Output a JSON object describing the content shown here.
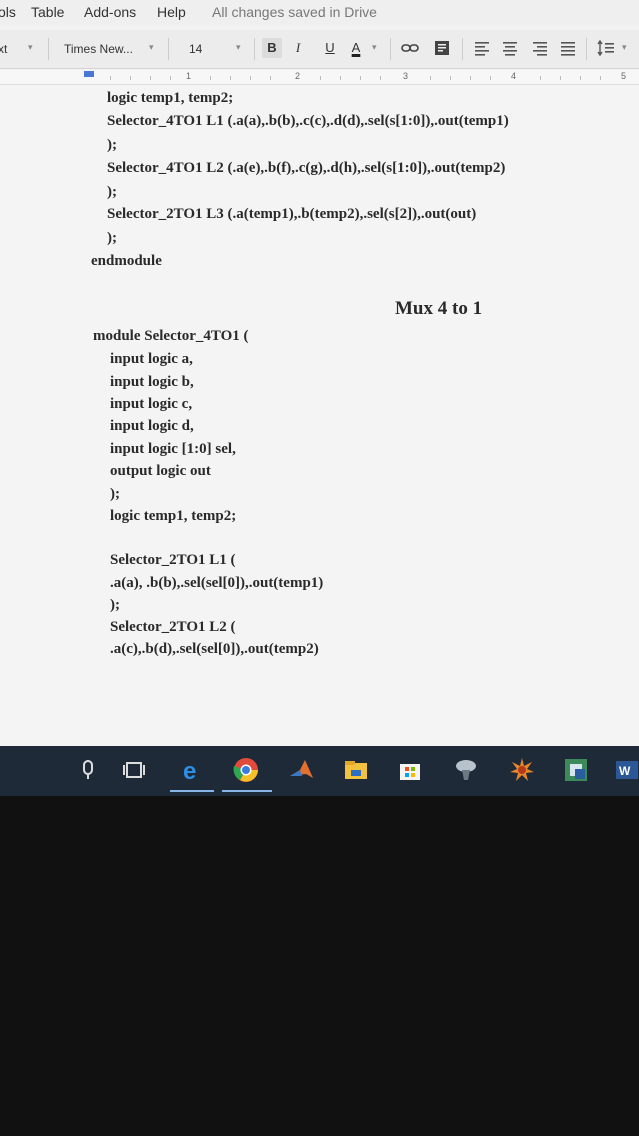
{
  "menubar": {
    "items": [
      "ols",
      "Table",
      "Add-ons",
      "Help"
    ],
    "status": "All changes saved in Drive"
  },
  "toolbar": {
    "style": "xt",
    "font": "Times New...",
    "size": "14",
    "bold": "B",
    "italic": "I",
    "underline": "U",
    "color": "A"
  },
  "ruler": {
    "numbers": [
      "1",
      "2",
      "3",
      "4",
      "5"
    ]
  },
  "document": {
    "lines": [
      "logic temp1, temp2;",
      "Selector_4TO1 L1 (.a(a),.b(b),.c(c),.d(d),.sel(s[1:0]),.out(temp1)",
      ");",
      "Selector_4TO1 L2 (.a(e),.b(f),.c(g),.d(h),.sel(s[1:0]),.out(temp2)",
      ");",
      "Selector_2TO1 L3 (.a(temp1),.b(temp2),.sel(s[2]),.out(out)",
      ");",
      "endmodule",
      "Mux 4 to 1",
      "module Selector_4TO1 (",
      "input logic a,",
      "input logic b,",
      "input logic c,",
      "input logic d,",
      "input logic [1:0] sel,",
      "output logic out",
      ");",
      "logic temp1, temp2;",
      "Selector_2TO1 L1 (",
      ".a(a), .b(b),.sel(sel[0]),.out(temp1)",
      ");",
      "Selector_2TO1 L2 (",
      ".a(c),.b(d),.sel(sel[0]),.out(temp2)"
    ]
  },
  "taskbar": {
    "icons": [
      "microphone-icon",
      "task-view-icon",
      "edge-icon",
      "chrome-icon",
      "matlab-icon",
      "file-explorer-icon",
      "store-icon",
      "network-app-icon",
      "settings-app-icon",
      "image-app-icon",
      "word-icon"
    ],
    "word_label": "W"
  }
}
